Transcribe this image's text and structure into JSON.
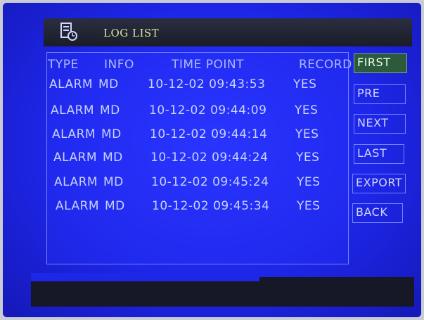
{
  "window": {
    "title": "LOG LIST"
  },
  "table": {
    "headers": {
      "type": "TYPE",
      "info": "INFO",
      "time": "TIME POINT",
      "record": "RECORD"
    },
    "rows": [
      {
        "type": "ALARM",
        "info": "MD",
        "time": "10-12-02 09:43:53",
        "record": "YES"
      },
      {
        "type": "ALARM",
        "info": "MD",
        "time": "10-12-02 09:44:09",
        "record": "YES"
      },
      {
        "type": "ALARM",
        "info": "MD",
        "time": "10-12-02 09:44:14",
        "record": "YES"
      },
      {
        "type": "ALARM",
        "info": "MD",
        "time": "10-12-02 09:44:24",
        "record": "YES"
      },
      {
        "type": "ALARM",
        "info": "MD",
        "time": "10-12-02 09:45:24",
        "record": "YES"
      },
      {
        "type": "ALARM",
        "info": "MD",
        "time": "10-12-02 09:45:34",
        "record": "YES"
      }
    ]
  },
  "buttons": {
    "first": "FIRST",
    "pre": "PRE",
    "next": "NEXT",
    "last": "LAST",
    "export": "EXPORT",
    "back": "BACK"
  },
  "icons": {
    "title_icon": "log-list-icon"
  },
  "colors": {
    "screen_blue": "#1e26e8",
    "active_button": "#2c5a3a",
    "text": "#c9d2ff"
  }
}
